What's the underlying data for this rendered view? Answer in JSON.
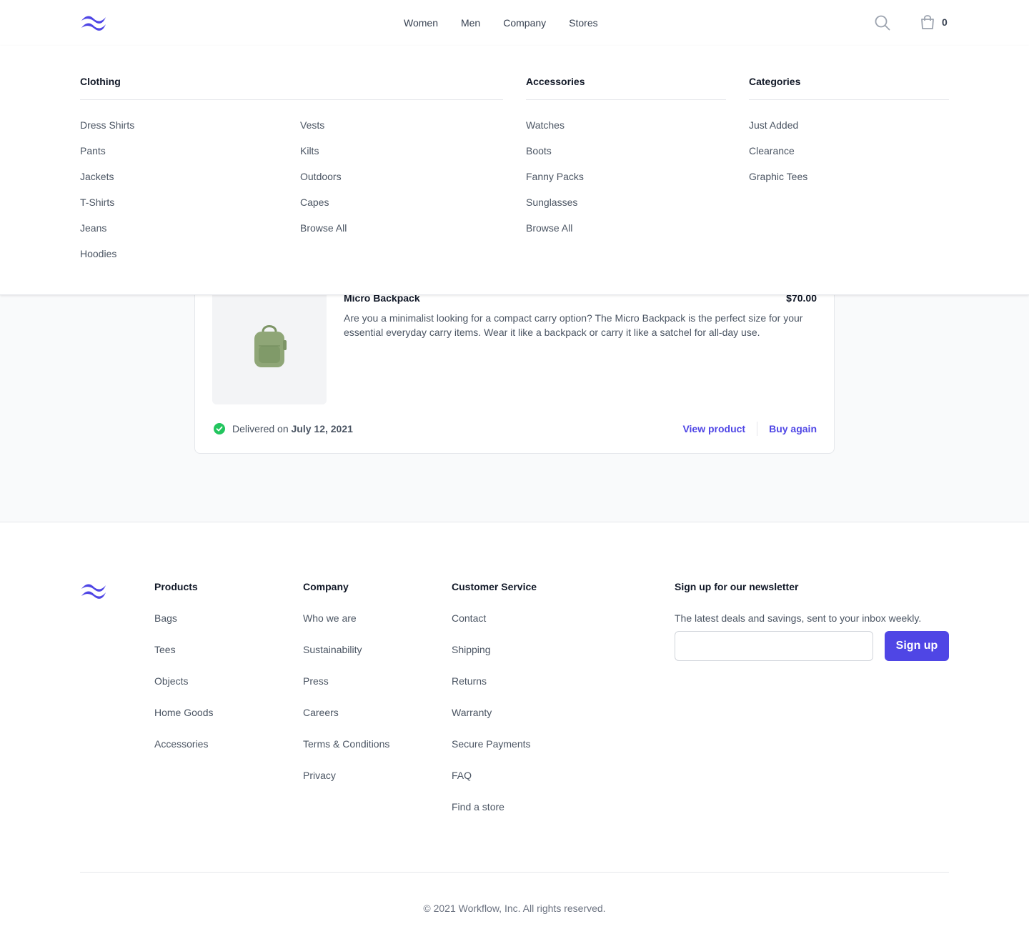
{
  "colors": {
    "accent": "#4f46e5",
    "success": "#22c55e",
    "backpack": "#8fa677"
  },
  "header": {
    "logo": "wave-logo",
    "nav": [
      "Women",
      "Men",
      "Company",
      "Stores"
    ],
    "cart_count": "0"
  },
  "flyout": {
    "clothing": {
      "title": "Clothing",
      "col1": [
        "Dress Shirts",
        "Pants",
        "Jackets",
        "T-Shirts",
        "Jeans",
        "Hoodies"
      ],
      "col2": [
        "Vests",
        "Kilts",
        "Outdoors",
        "Capes",
        "Browse All"
      ]
    },
    "accessories": {
      "title": "Accessories",
      "items": [
        "Watches",
        "Boots",
        "Fanny Packs",
        "Sunglasses",
        "Browse All"
      ]
    },
    "categories": {
      "title": "Categories",
      "items": [
        "Just Added",
        "Clearance",
        "Graphic Tees"
      ]
    }
  },
  "order": {
    "product_name": "Micro Backpack",
    "price": "$70.00",
    "description": "Are you a minimalist looking for a compact carry option? The Micro Backpack is the perfect size for your essential everyday carry items. Wear it like a backpack or carry it like a satchel for all-day use.",
    "status_prefix": "Delivered on ",
    "status_date": "July 12, 2021",
    "view_product": "View product",
    "buy_again": "Buy again"
  },
  "footer": {
    "products": {
      "title": "Products",
      "items": [
        "Bags",
        "Tees",
        "Objects",
        "Home Goods",
        "Accessories"
      ]
    },
    "company": {
      "title": "Company",
      "items": [
        "Who we are",
        "Sustainability",
        "Press",
        "Careers",
        "Terms & Conditions",
        "Privacy"
      ]
    },
    "service": {
      "title": "Customer Service",
      "items": [
        "Contact",
        "Shipping",
        "Returns",
        "Warranty",
        "Secure Payments",
        "FAQ",
        "Find a store"
      ]
    },
    "newsletter": {
      "title": "Sign up for our newsletter",
      "description": "The latest deals and savings, sent to your inbox weekly.",
      "button": "Sign up",
      "placeholder": ""
    },
    "copyright": "© 2021 Workflow, Inc. All rights reserved."
  }
}
